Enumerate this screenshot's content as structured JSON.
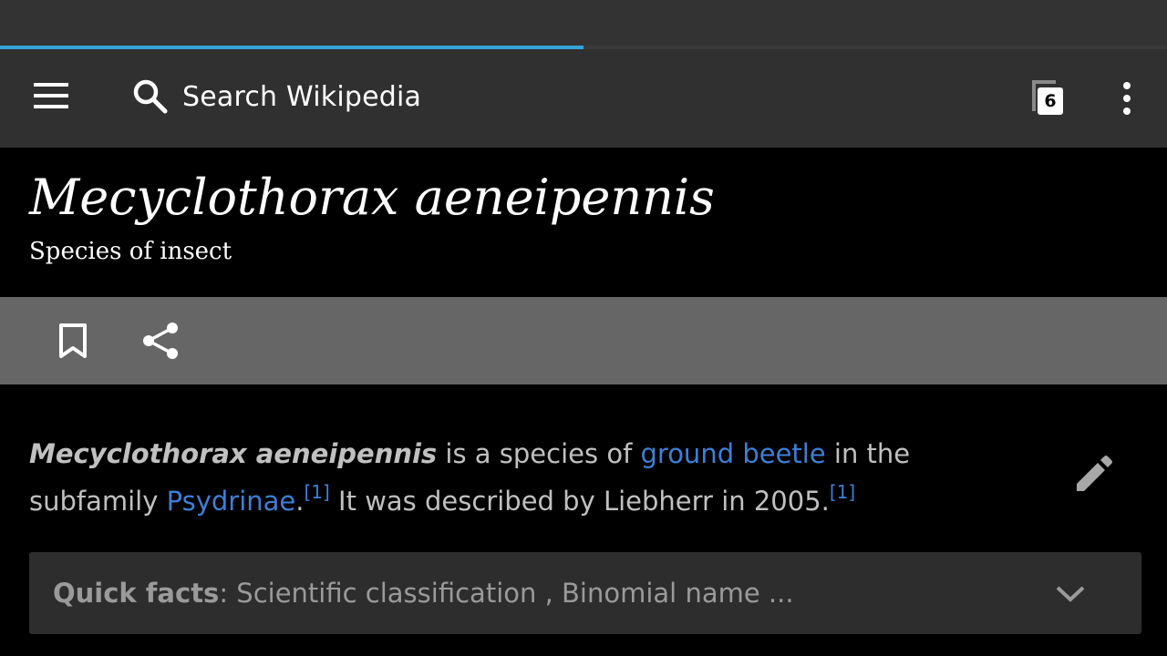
{
  "progress": {
    "fraction": 0.5,
    "color": "#36a3d9"
  },
  "toolbar": {
    "menu_icon": "hamburger-menu-icon",
    "search_placeholder": "Search Wikipedia",
    "search_icon": "search-icon",
    "tabs_count": "6",
    "overflow_icon": "more-vert-icon"
  },
  "article": {
    "title": "Mecyclothorax aeneipennis",
    "description": "Species of insect",
    "actions": [
      {
        "icon": "bookmark-icon"
      },
      {
        "icon": "share-icon"
      }
    ],
    "lead": {
      "bold_title": "Mecyclothorax aeneipennis",
      "text1": " is a species of ",
      "link1": "ground beetle",
      "text2": " in the subfamily ",
      "link2": "Psydrinae",
      "text3": ".",
      "ref1": "[1]",
      "text4": " It was described by Liebherr in 2005.",
      "ref2": "[1]"
    },
    "edit_icon": "pencil-edit-icon",
    "quick_facts": {
      "label": "Quick facts",
      "text": ": Scientific classification , Binomial name ...",
      "icon": "chevron-down-icon"
    }
  },
  "colors": {
    "link": "#3e7fd6",
    "toolbar_bg": "#303030",
    "action_bar_bg": "#666666"
  }
}
